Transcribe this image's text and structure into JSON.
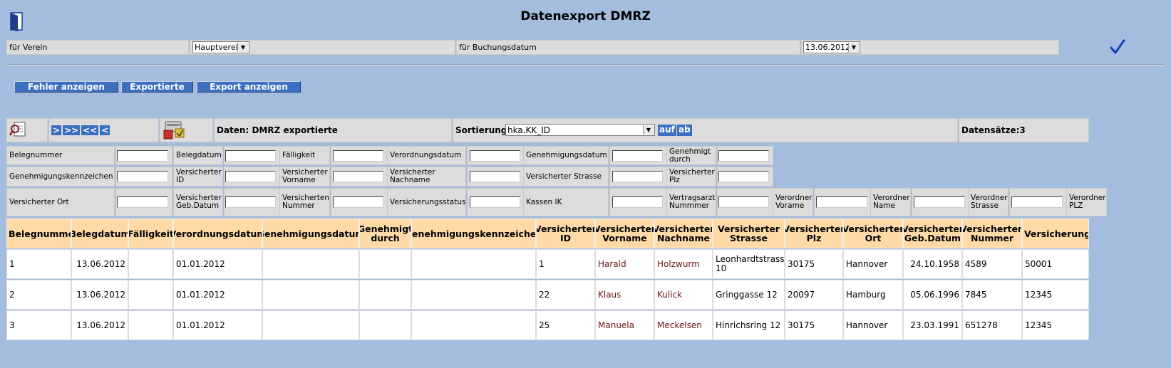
{
  "page": {
    "title": "Datenexport DMRZ"
  },
  "icons": {
    "exit": "door-exit-icon",
    "search": "magnifier-document-icon",
    "export": "export-package-icon",
    "confirm": "checkmark-icon"
  },
  "filter": {
    "verein_label": "für Verein",
    "verein_value": "Hauptverein",
    "datum_label": "für Buchungsdatum",
    "datum_value": "13.06.2012"
  },
  "buttons": {
    "fehler": "Fehler anzeigen",
    "exportierte": "Exportierte",
    "export": "Export anzeigen"
  },
  "nav": {
    "next": ">",
    "last": ">>",
    "first": "<<",
    "prev": "<"
  },
  "toolbar": {
    "daten": "Daten: DMRZ exportierte",
    "sort_label": "Sortierung",
    "sort_value": "hka.KK_ID",
    "asc": "auf",
    "desc": "ab",
    "records": "Datensätze:3"
  },
  "fields": {
    "row1": [
      "Belegnummer",
      "Belegdatum",
      "Fälligkeit",
      "Verordnungsdatum",
      "Genehmigungsdatum",
      "Genehmigt durch"
    ],
    "row2": [
      "Genehmigungskennzeichen",
      "Versicherter ID",
      "Versicherter Vorname",
      "Versicherter Nachname",
      "Versicherter Strasse",
      "Versicherter Plz"
    ],
    "row3": [
      "Versicherter Ort",
      "Versicherter Geb.Datum",
      "Versicherten Nummer",
      "Versicherungsstatus",
      "Kassen IK",
      "Vertragsarzt Nummmer",
      "Verordner Vorame",
      "Verordner Name",
      "Verordner Strasse",
      "Verordner PLZ"
    ]
  },
  "table": {
    "headers": [
      "Belegnummer",
      "Belegdatum",
      "Fälligkeit",
      "Verordnungsdatum",
      "Genehmigungsdatum",
      "Genehmigt durch",
      "Genehmigungskennzeichen",
      "Versicherter ID",
      "Versicherter Vorname",
      "Versicherter Nachname",
      "Versicherter Strasse",
      "Versicherter Plz",
      "Versicherter Ort",
      "Versicherter Geb.Datum",
      "Versicherten Nummer",
      "Versicherungsstatu"
    ],
    "rows": [
      [
        "1",
        "13.06.2012",
        "",
        "01.01.2012",
        "",
        "",
        "",
        "1",
        "Harald",
        "Holzwurm",
        "Leonhardtstrasse 10",
        "30175",
        "Hannover",
        "24.10.1958",
        "4589",
        "50001"
      ],
      [
        "2",
        "13.06.2012",
        "",
        "01.01.2012",
        "",
        "",
        "",
        "22",
        "Klaus",
        "Kulick",
        "Gringgasse 12",
        "20097",
        "Hamburg",
        "05.06.1996",
        "7845",
        "12345"
      ],
      [
        "3",
        "13.06.2012",
        "",
        "01.01.2012",
        "",
        "",
        "",
        "25",
        "Manuela",
        "Meckelsen",
        "Hinrichsring 12",
        "30175",
        "Hannover",
        "23.03.1991",
        "651278",
        "12345"
      ]
    ]
  }
}
